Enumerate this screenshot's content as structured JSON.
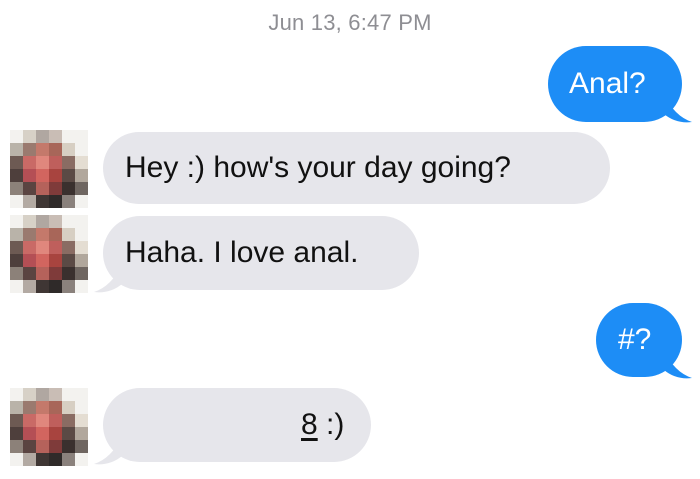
{
  "conversation": {
    "timestamp": "Jun 13, 6:47 PM",
    "messages": [
      {
        "direction": "sent",
        "text": "Anal?"
      },
      {
        "direction": "received",
        "text": "Hey :) how's your day going?"
      },
      {
        "direction": "received",
        "text": "Haha. I love anal."
      },
      {
        "direction": "sent",
        "text": "#?"
      },
      {
        "direction": "received",
        "number": "8",
        "suffix": " :)"
      }
    ]
  },
  "colors": {
    "sent_bubble": "#1d8df6",
    "received_bubble": "#e6e6eb",
    "timestamp_text": "#8e8e93"
  },
  "icons": {
    "avatar": "pixelated-contact-avatar"
  }
}
